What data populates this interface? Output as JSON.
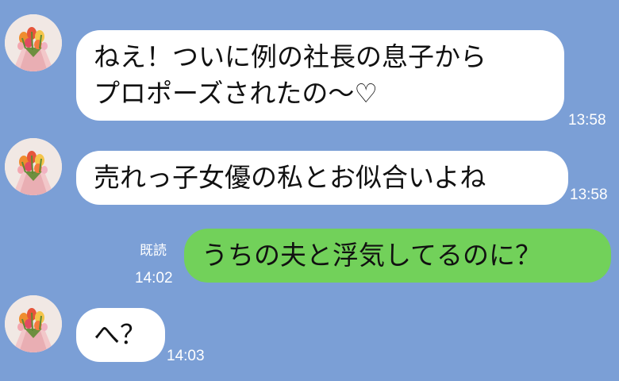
{
  "chat": {
    "messages": [
      {
        "side": "received",
        "lines": [
          "ねえ！ついに例の社長の息子から",
          "プロポーズされたの〜♡"
        ],
        "time": "13:58",
        "avatar": "bouquet-avatar"
      },
      {
        "side": "received",
        "lines": [
          "売れっ子女優の私とお似合いよね"
        ],
        "time": "13:58",
        "avatar": "bouquet-avatar"
      },
      {
        "side": "sent",
        "lines": [
          "うちの夫と浮気してるのに？"
        ],
        "read": "既読",
        "time": "14:02"
      },
      {
        "side": "received",
        "lines": [
          "へ？"
        ],
        "time": "14:03",
        "avatar": "bouquet-avatar"
      }
    ]
  },
  "colors": {
    "background": "#7b9fd6",
    "received_bubble": "#ffffff",
    "sent_bubble": "#72d15a",
    "text": "#111111",
    "meta_text": "#ffffff"
  }
}
